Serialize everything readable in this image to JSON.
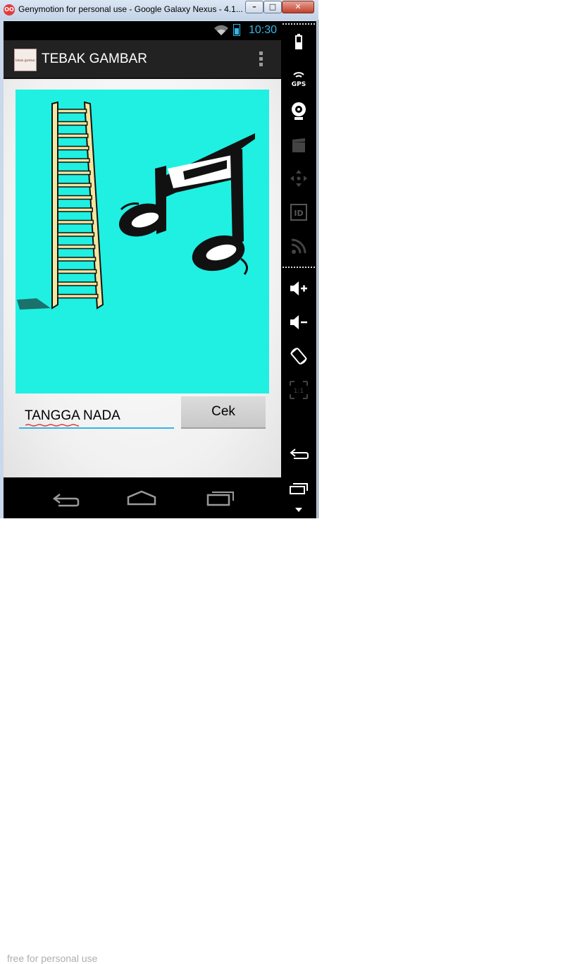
{
  "window": {
    "title": "Genymotion for personal use - Google Galaxy Nexus - 4.1...",
    "icon_text": "OO",
    "minimize_symbol": "–",
    "maximize_symbol": "□",
    "close_symbol": "✕"
  },
  "statusbar": {
    "time": "10:30"
  },
  "actionbar": {
    "title": "TEBAK GAMBAR",
    "icon_label": "tebak gambar"
  },
  "main": {
    "puzzle_background": "#1ff0e2",
    "answer_value": "TANGGA NADA",
    "button_label": "Cek"
  },
  "navbar": {
    "watermark": "free for personal use"
  },
  "sidebar": {
    "gps_label": "GPS",
    "id_label": "ID",
    "ratio_label": "1:1"
  },
  "colors": {
    "accent": "#33b5e5",
    "actionbar": "#222222",
    "close": "#c0412c"
  }
}
